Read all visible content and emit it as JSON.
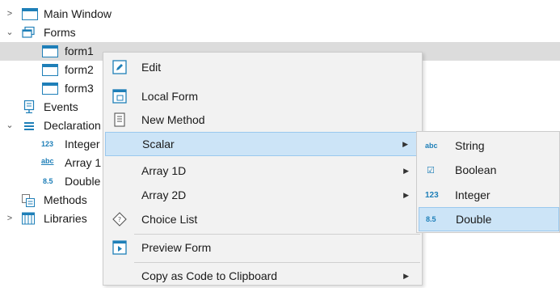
{
  "tree": {
    "items": [
      {
        "label": "Main Window",
        "caret": ">",
        "icon": "window-icon"
      },
      {
        "label": "Forms",
        "caret": "v",
        "icon": "forms-icon"
      },
      {
        "label": "form1",
        "icon": "form-icon"
      },
      {
        "label": "form2",
        "icon": "form-icon"
      },
      {
        "label": "form3",
        "icon": "form-icon"
      },
      {
        "label": "Events",
        "icon": "events-icon"
      },
      {
        "label": "Declaration",
        "caret": "v",
        "icon": "declarations-icon"
      },
      {
        "label": "Integer",
        "badge": "123"
      },
      {
        "label": "Array 1",
        "badge": "abc"
      },
      {
        "label": "Double",
        "badge": "8.5"
      },
      {
        "label": "Methods",
        "icon": "methods-icon"
      },
      {
        "label": "Libraries",
        "caret": ">",
        "icon": "libraries-icon"
      }
    ]
  },
  "menu": {
    "items": [
      {
        "label": "Edit",
        "icon": "edit-icon"
      },
      {
        "label": "Local Form",
        "icon": "local-form-icon"
      },
      {
        "label": "New Method",
        "icon": "new-method-icon"
      },
      {
        "label": "Scalar",
        "arrow": "▶"
      },
      {
        "label": "Array 1D",
        "arrow": "▶"
      },
      {
        "label": "Array 2D",
        "arrow": "▶"
      },
      {
        "label": "Choice List",
        "icon": "choice-list-icon"
      },
      {
        "label": "Preview Form",
        "icon": "preview-form-icon"
      },
      {
        "label": "Copy as Code to Clipboard",
        "arrow": "▶"
      }
    ]
  },
  "submenu": {
    "items": [
      {
        "label": "String",
        "badge": "abc"
      },
      {
        "label": "Boolean",
        "badge": "☑"
      },
      {
        "label": "Integer",
        "badge": "123"
      },
      {
        "label": "Double",
        "badge": "8.5"
      }
    ]
  },
  "colors": {
    "accent": "#1e7fb8",
    "highlight": "#cce4f7",
    "selection": "#dcdcdc"
  }
}
